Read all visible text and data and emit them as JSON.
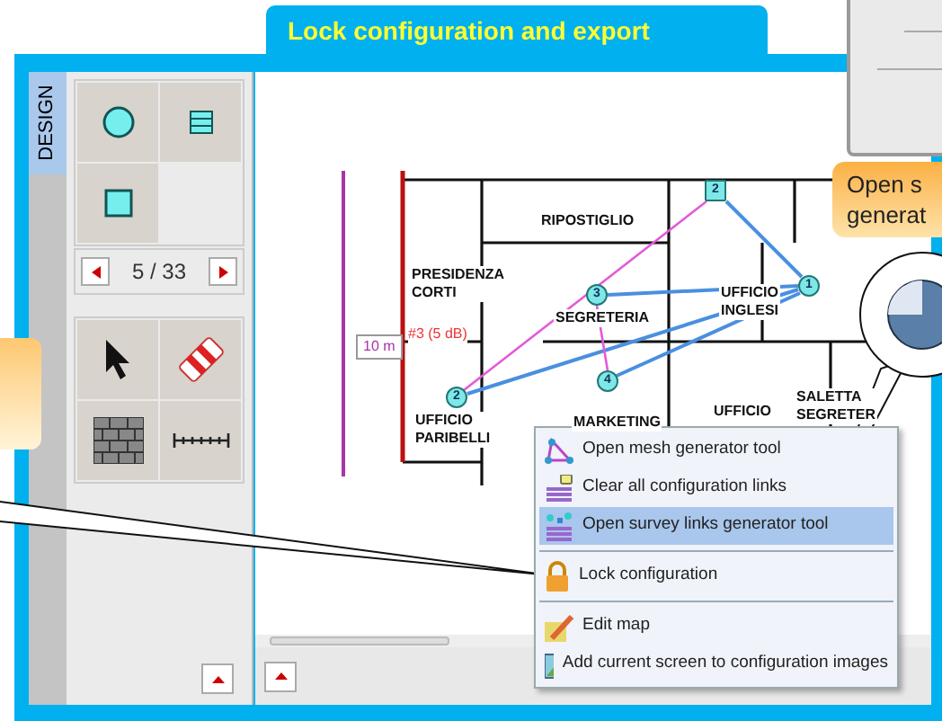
{
  "title": "Lock configuration and export",
  "design_tab": {
    "label": "DESIGN",
    "selected": true
  },
  "pager": {
    "text": "5 / 33"
  },
  "floor_plan": {
    "rooms": [
      {
        "label": "RIPOSTIGLIO"
      },
      {
        "label": "PRESIDENZA\nCORTI"
      },
      {
        "label": "SEGRETERIA"
      },
      {
        "label": "UFFICIO\nINGLESI"
      },
      {
        "label": "UFFICIO\nPARIBELLI"
      },
      {
        "label": "MARKETING"
      },
      {
        "label": "UFFICIO"
      },
      {
        "label": "SALETTA\nSEGRETER"
      }
    ],
    "nodes": [
      {
        "label": "2",
        "kind": "square"
      },
      {
        "label": "1",
        "kind": "circle"
      },
      {
        "label": "3",
        "kind": "circle"
      },
      {
        "label": "4",
        "kind": "circle"
      },
      {
        "label": "2",
        "kind": "circle"
      }
    ],
    "scale_label": "10 m",
    "link_label": "#3 (5 dB)"
  },
  "context_menu": [
    {
      "label": "Open mesh generator tool",
      "selected": false,
      "separator_after": false
    },
    {
      "label": "Clear all configuration links",
      "selected": false,
      "separator_after": false
    },
    {
      "label": "Open survey links generator tool",
      "selected": true,
      "separator_after": true
    },
    {
      "label": "Lock configuration",
      "selected": false,
      "separator_after": true
    },
    {
      "label": "Edit map",
      "selected": false,
      "separator_after": false
    },
    {
      "label": "Add current screen to configuration images",
      "selected": false,
      "separator_after": false
    }
  ],
  "callout": {
    "lines": [
      "Open s",
      "generat"
    ]
  }
}
